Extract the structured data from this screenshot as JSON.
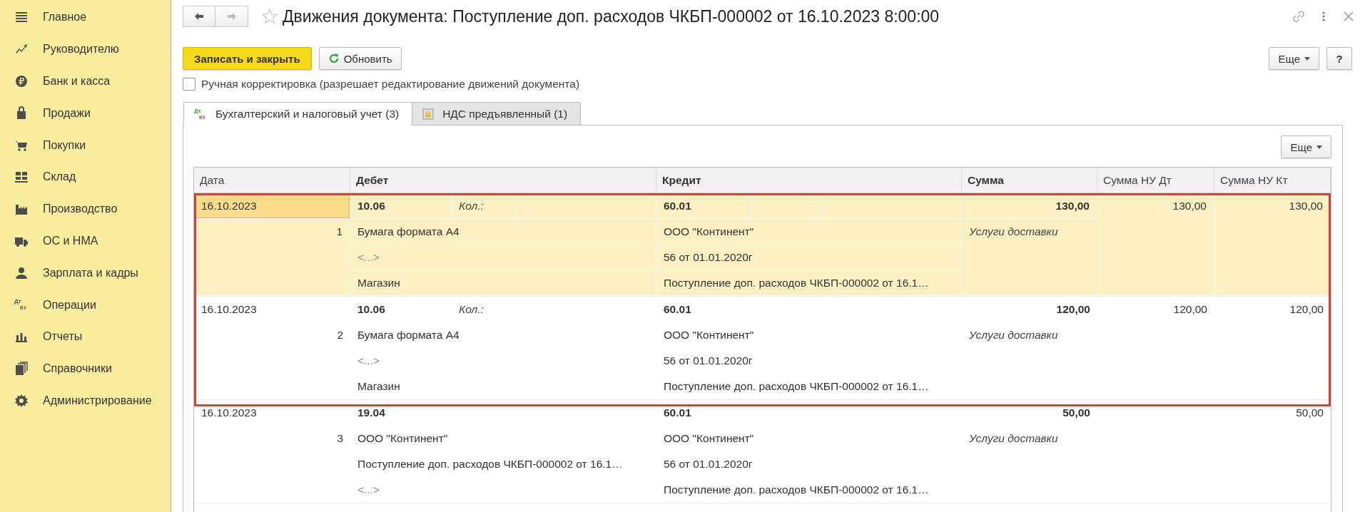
{
  "sidebar": {
    "items": [
      {
        "label": "Главное"
      },
      {
        "label": "Руководителю"
      },
      {
        "label": "Банк и касса"
      },
      {
        "label": "Продажи"
      },
      {
        "label": "Покупки"
      },
      {
        "label": "Склад"
      },
      {
        "label": "Производство"
      },
      {
        "label": "ОС и НМА"
      },
      {
        "label": "Зарплата и кадры"
      },
      {
        "label": "Операции",
        "icon_text": [
          "Дт",
          "Кт"
        ]
      },
      {
        "label": "Отчеты"
      },
      {
        "label": "Справочники"
      },
      {
        "label": "Администрирование"
      }
    ]
  },
  "window": {
    "title": "Движения документа: Поступление доп. расходов ЧКБП-000002 от 16.10.2023 8:00:00"
  },
  "toolbar": {
    "buttons": [
      {
        "label": "Записать и закрыть",
        "kind": "primary"
      },
      {
        "label": "Обновить",
        "kind": "refresh"
      }
    ],
    "more": "Еще",
    "help": "?"
  },
  "manual_edit": {
    "label": "Ручная корректировка (разрешает редактирование движений документа)",
    "checked": false
  },
  "tabs": [
    {
      "label": "Бухгалтерский и налоговый учет (3)",
      "selected": true,
      "icon_text": [
        "Дт",
        "Кт"
      ]
    },
    {
      "label": "НДС предъявленный (1)",
      "selected": false
    }
  ],
  "table": {
    "more": "Еще",
    "columns": [
      {
        "label": "Дата",
        "bold": false
      },
      {
        "label": "Дебет",
        "bold": true
      },
      {
        "label": "Кредит",
        "bold": true
      },
      {
        "label": "Сумма",
        "bold": true
      },
      {
        "label": "Сумма НУ Дт",
        "bold": false
      },
      {
        "label": "Сумма НУ Кт",
        "bold": false
      }
    ],
    "rows": [
      {
        "date": "16.10.2023",
        "number": "1",
        "selected": true,
        "date_focused": true,
        "outlined": true,
        "debit": {
          "account": "10.06",
          "qty_label": "Кол.:",
          "lines": [
            {
              "text": "Бумага формата А4",
              "muted": false
            },
            {
              "text": "<...>",
              "muted": true
            },
            {
              "text": "Магазин",
              "muted": false
            }
          ]
        },
        "credit": {
          "account": "60.01",
          "lines": [
            {
              "text": "ООО \"Континент\"",
              "muted": false
            },
            {
              "text": "56 от 01.01.2020г",
              "muted": false
            },
            {
              "text": "Поступление доп. расходов ЧКБП-000002 от 16.1…",
              "muted": false
            }
          ]
        },
        "amount": "130,00",
        "amount_note": "Услуги доставки",
        "nu_dt": "130,00",
        "nu_kt": "130,00"
      },
      {
        "date": "16.10.2023",
        "number": "2",
        "selected": false,
        "date_focused": false,
        "outlined": true,
        "debit": {
          "account": "10.06",
          "qty_label": "Кол.:",
          "lines": [
            {
              "text": "Бумага формата А4",
              "muted": false
            },
            {
              "text": "<...>",
              "muted": true
            },
            {
              "text": "Магазин",
              "muted": false
            }
          ]
        },
        "credit": {
          "account": "60.01",
          "lines": [
            {
              "text": "ООО \"Континент\"",
              "muted": false
            },
            {
              "text": "56 от 01.01.2020г",
              "muted": false
            },
            {
              "text": "Поступление доп. расходов ЧКБП-000002 от 16.1…",
              "muted": false
            }
          ]
        },
        "amount": "120,00",
        "amount_note": "Услуги доставки",
        "nu_dt": "120,00",
        "nu_kt": "120,00"
      },
      {
        "date": "16.10.2023",
        "number": "3",
        "selected": false,
        "date_focused": false,
        "outlined": false,
        "debit": {
          "account": "19.04",
          "lines": [
            {
              "text": "ООО \"Континент\"",
              "muted": false
            },
            {
              "text": "Поступление доп. расходов ЧКБП-000002 от 16.1…",
              "muted": false
            },
            {
              "text": "<...>",
              "muted": true
            }
          ]
        },
        "credit": {
          "account": "60.01",
          "lines": [
            {
              "text": "ООО \"Континент\"",
              "muted": false
            },
            {
              "text": "56 от 01.01.2020г",
              "muted": false
            },
            {
              "text": "Поступление доп. расходов ЧКБП-000002 от 16.1…",
              "muted": false
            }
          ]
        },
        "amount": "50,00",
        "amount_note": "Услуги доставки",
        "nu_kt": "50,00"
      }
    ]
  }
}
